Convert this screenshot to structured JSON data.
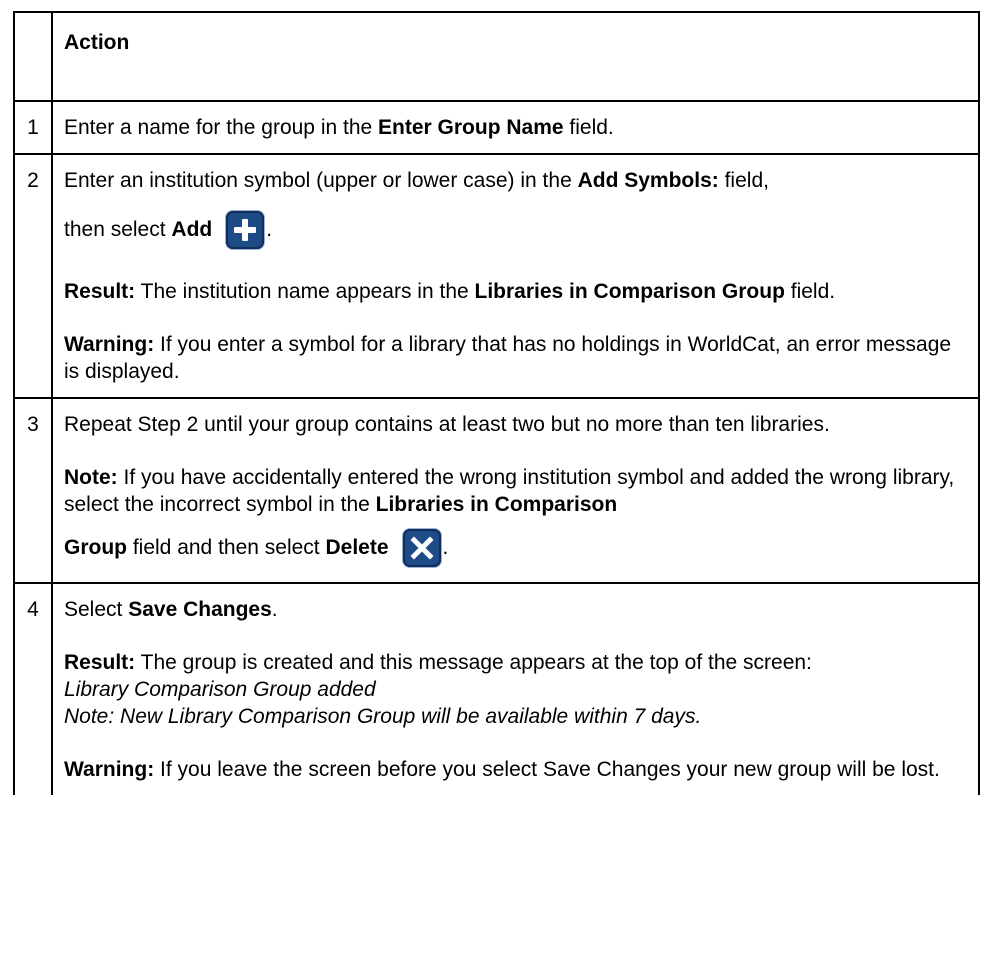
{
  "header": {
    "num": "",
    "action": "Action"
  },
  "steps": [
    {
      "num": "1",
      "s1_a": "Enter a name for the group in the ",
      "s1_b": "Enter Group Name",
      "s1_c": " field."
    },
    {
      "num": "2",
      "s2_a": "Enter an institution symbol (upper or lower case) in the ",
      "s2_b": "Add Symbols:",
      "s2_c": " field,",
      "s2_d": "then select ",
      "s2_e": "Add",
      "s2_f": ".",
      "s2_res_label": "Result:",
      "s2_res_a": " The institution name appears in the ",
      "s2_res_b": "Libraries in Comparison Group",
      "s2_res_c": " field.",
      "s2_warn_label": "Warning:",
      "s2_warn_text": "  If you enter a symbol for a library that has no holdings in WorldCat, an error message is displayed."
    },
    {
      "num": "3",
      "s3_a": "Repeat Step 2 until your group contains at least two but no more than ten libraries.",
      "s3_note_label": "Note:",
      "s3_note_a": " If you have accidentally entered the wrong institution symbol and added the wrong library, select the incorrect symbol in the ",
      "s3_note_b": "Libraries in Comparison",
      "s3_note_c": "Group",
      "s3_note_d": " field and then select ",
      "s3_note_e": "Delete",
      "s3_note_f": "."
    },
    {
      "num": "4",
      "s4_a": "Select ",
      "s4_b": "Save Changes",
      "s4_c": ".",
      "s4_res_label": "Result:",
      "s4_res_text": " The group is created and this message appears at the top of the screen:",
      "s4_msg1": "Library Comparison Group added",
      "s4_msg2": "Note: New Library Comparison Group will be available within 7 days.",
      "s4_warn_label": "Warning:",
      "s4_warn_text": " If you leave the screen before you select Save Changes your new group will be lost."
    }
  ],
  "icons": {
    "add": "plus-icon",
    "delete": "x-icon",
    "icon_color": "#1e4a86"
  }
}
